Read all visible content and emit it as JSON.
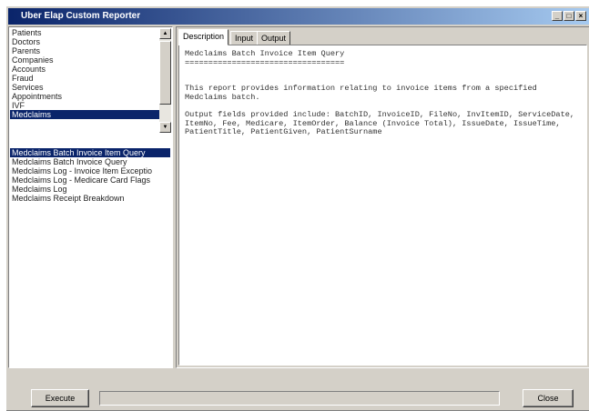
{
  "window": {
    "title": "Uber Elap Custom Reporter"
  },
  "titlebar_controls": [
    "_",
    "□",
    "×"
  ],
  "categories": [
    {
      "label": "Patients",
      "selected": false
    },
    {
      "label": "Doctors",
      "selected": false
    },
    {
      "label": "Parents",
      "selected": false
    },
    {
      "label": "Companies",
      "selected": false
    },
    {
      "label": "Accounts",
      "selected": false
    },
    {
      "label": "Fraud",
      "selected": false
    },
    {
      "label": "Services",
      "selected": false
    },
    {
      "label": "Appointments",
      "selected": false
    },
    {
      "label": "IVF",
      "selected": false
    },
    {
      "label": "Medclaims",
      "selected": true
    }
  ],
  "reports": [
    {
      "label": "Medclaims Batch Invoice Item Query",
      "selected": true
    },
    {
      "label": "Medclaims Batch Invoice Query",
      "selected": false
    },
    {
      "label": "Medclaims Log - Invoice Item Exceptio",
      "selected": false
    },
    {
      "label": "Medclaims Log - Medicare Card Flags",
      "selected": false
    },
    {
      "label": "Medclaims Log",
      "selected": false
    },
    {
      "label": "Medclaims Receipt Breakdown",
      "selected": false
    }
  ],
  "tabs": [
    {
      "label": "Description",
      "active": true
    },
    {
      "label": "Input",
      "active": false
    },
    {
      "label": "Output",
      "active": false
    }
  ],
  "description": {
    "heading": "Medclaims Batch Invoice Item Query",
    "underline": "==================================",
    "body1": "This report provides information relating to invoice items from a specified Medclaims batch.",
    "body2": "Output fields provided include: BatchID, InvoiceID, FileNo, InvItemID, ServiceDate, ItemNo, Fee, Medicare, ItemOrder, Balance (Invoice Total), IssueDate, IssueTime, PatientTitle, PatientGiven, PatientSurname"
  },
  "buttons": {
    "execute": "Execute",
    "close": "Close"
  }
}
